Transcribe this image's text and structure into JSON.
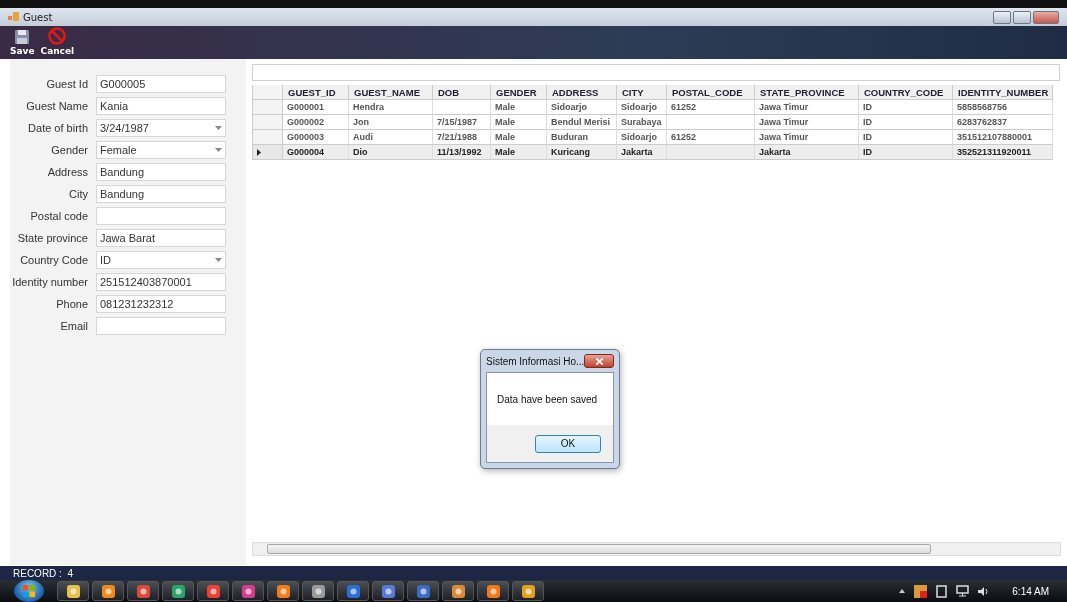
{
  "window": {
    "title": "Guest"
  },
  "toolbar": [
    {
      "label": "Save",
      "kind": "save"
    },
    {
      "label": "Cancel",
      "kind": "cancel"
    }
  ],
  "form": [
    {
      "label": "Guest Id",
      "value": "G000005",
      "kind": "text"
    },
    {
      "label": "Guest Name",
      "value": "Kania",
      "kind": "text"
    },
    {
      "label": "Date of birth",
      "value": "3/24/1987",
      "kind": "dropdown"
    },
    {
      "label": "Gender",
      "value": "Female",
      "kind": "dropdown"
    },
    {
      "label": "Address",
      "value": "Bandung",
      "kind": "text"
    },
    {
      "label": "City",
      "value": "Bandung",
      "kind": "text"
    },
    {
      "label": "Postal code",
      "kind": "text"
    },
    {
      "label": "State province",
      "value": "Jawa Barat",
      "kind": "text"
    },
    {
      "label": "Country Code",
      "value": "ID",
      "kind": "dropdown"
    },
    {
      "label": "Identity number",
      "value": "251512403870001",
      "kind": "text"
    },
    {
      "label": "Phone",
      "value": "081231232312",
      "kind": "text"
    },
    {
      "label": "Email",
      "kind": "text"
    }
  ],
  "table": {
    "columns": [
      "GUEST_ID",
      "GUEST_NAME",
      "DOB",
      "GENDER",
      "ADDRESS",
      "CITY",
      "POSTAL_CODE",
      "STATE_PROVINCE",
      "COUNTRY_CODE",
      "IDENTITY_NUMBER"
    ],
    "rows": [
      {
        "selected": false,
        "cells": [
          "G000001",
          "Hendra",
          "",
          "Male",
          "Sidoarjo",
          "Sidoarjo",
          "61252",
          "Jawa Timur",
          "ID",
          "5858568756"
        ]
      },
      {
        "selected": false,
        "cells": [
          "G000002",
          "Jon",
          "7/15/1987",
          "Male",
          "Bendul Merisi",
          "Surabaya",
          "",
          "Jawa Timur",
          "ID",
          "6283762837"
        ]
      },
      {
        "selected": false,
        "cells": [
          "G000003",
          "Audi",
          "7/21/1988",
          "Male",
          "Buduran",
          "Sidoarjo",
          "61252",
          "Jawa Timur",
          "ID",
          "351512107880001"
        ]
      },
      {
        "selected": true,
        "cells": [
          "G000004",
          "Dio",
          "11/13/1992",
          "Male",
          "Kuricang",
          "Jakarta",
          "",
          "Jakarta",
          "ID",
          "352521311920011"
        ]
      }
    ]
  },
  "dialog": {
    "title": "Sistem Informasi Ho...",
    "message": "Data have been saved",
    "button": "OK"
  },
  "status_bar": {
    "text": "RECORD :  4"
  },
  "taskbar": {
    "clock": "6:14 AM"
  }
}
